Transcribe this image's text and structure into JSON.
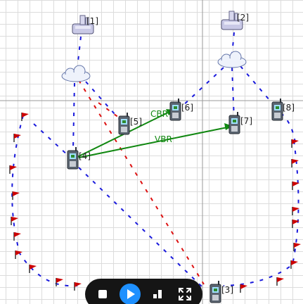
{
  "nodes": [
    {
      "id": "n1",
      "label": "[1]",
      "kind": "router"
    },
    {
      "id": "n2",
      "label": "[2]",
      "kind": "router"
    },
    {
      "id": "n3",
      "label": "[3]",
      "kind": "mobile"
    },
    {
      "id": "n4",
      "label": "[4]",
      "kind": "mobile"
    },
    {
      "id": "n5",
      "label": "[5]",
      "kind": "mobile"
    },
    {
      "id": "n6",
      "label": "[6]",
      "kind": "mobile"
    },
    {
      "id": "n7",
      "label": "[7]",
      "kind": "mobile"
    },
    {
      "id": "n8",
      "label": "[8]",
      "kind": "mobile"
    }
  ],
  "flows": [
    {
      "id": "cbr",
      "label": "CBR",
      "from": "n4",
      "to": "n6",
      "color": "#118811"
    },
    {
      "id": "vbr",
      "label": "VBR",
      "from": "n4",
      "to": "n7",
      "color": "#118811"
    }
  ],
  "colors": {
    "link_blue": "#1a1adc",
    "link_red": "#dd1111",
    "flow_green": "#118811",
    "waypoint_flag": "#cc0000",
    "controls_bg": "#151515",
    "play_accent": "#1e90ff"
  },
  "controls": [
    {
      "id": "stop",
      "icon": "stop-icon"
    },
    {
      "id": "play",
      "icon": "play-icon"
    },
    {
      "id": "signal",
      "icon": "signal-icon"
    },
    {
      "id": "fullscreen",
      "icon": "fullscreen-icon"
    }
  ]
}
